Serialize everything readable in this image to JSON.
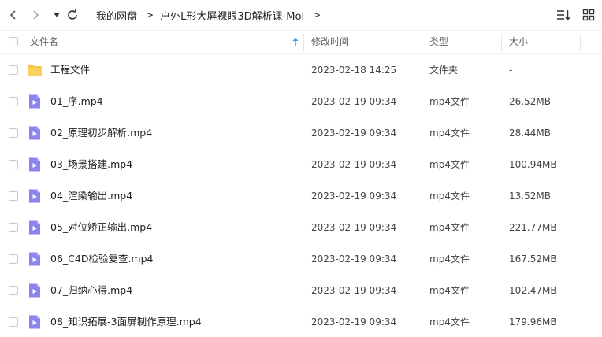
{
  "breadcrumb": {
    "root": "我的网盘",
    "current": "户外L形大屏裸眼3D解析课-Moi",
    "separator": ">"
  },
  "columns": {
    "name": "文件名",
    "modified": "修改时间",
    "type": "类型",
    "size": "大小"
  },
  "sort": {
    "column": "name",
    "direction": "ascending"
  },
  "colors": {
    "folder": "#f7c443",
    "video_icon": "#8c84ef",
    "sort_arrow": "#2ea0e8"
  },
  "files": [
    {
      "name": "工程文件",
      "modified": "2023-02-18 14:25",
      "type": "文件夹",
      "size": "-",
      "icon": "folder-icon"
    },
    {
      "name": "01_序.mp4",
      "modified": "2023-02-19 09:34",
      "type": "mp4文件",
      "size": "26.52MB",
      "icon": "video-file-icon"
    },
    {
      "name": "02_原理初步解析.mp4",
      "modified": "2023-02-19 09:34",
      "type": "mp4文件",
      "size": "28.44MB",
      "icon": "video-file-icon"
    },
    {
      "name": "03_场景搭建.mp4",
      "modified": "2023-02-19 09:34",
      "type": "mp4文件",
      "size": "100.94MB",
      "icon": "video-file-icon"
    },
    {
      "name": "04_渲染输出.mp4",
      "modified": "2023-02-19 09:34",
      "type": "mp4文件",
      "size": "13.52MB",
      "icon": "video-file-icon"
    },
    {
      "name": "05_对位矫正输出.mp4",
      "modified": "2023-02-19 09:34",
      "type": "mp4文件",
      "size": "221.77MB",
      "icon": "video-file-icon"
    },
    {
      "name": "06_C4D检验复查.mp4",
      "modified": "2023-02-19 09:34",
      "type": "mp4文件",
      "size": "167.52MB",
      "icon": "video-file-icon"
    },
    {
      "name": "07_归纳心得.mp4",
      "modified": "2023-02-19 09:34",
      "type": "mp4文件",
      "size": "102.47MB",
      "icon": "video-file-icon"
    },
    {
      "name": "08_知识拓展-3面屏制作原理.mp4",
      "modified": "2023-02-19 09:34",
      "type": "mp4文件",
      "size": "179.96MB",
      "icon": "video-file-icon"
    }
  ]
}
